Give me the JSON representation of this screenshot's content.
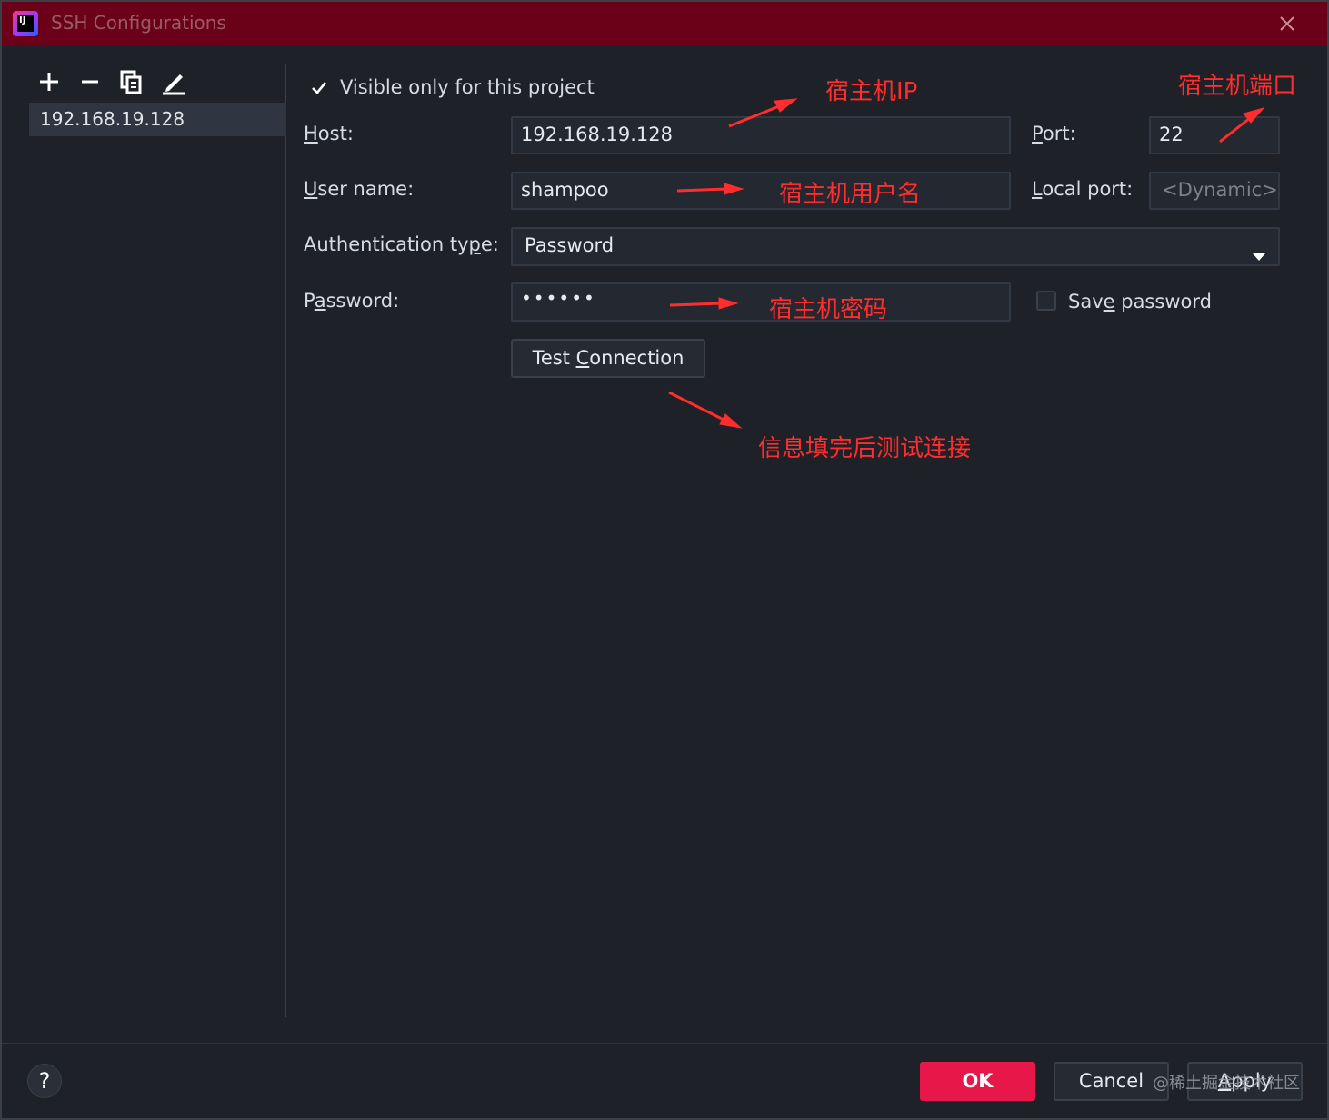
{
  "window": {
    "title": "SSH Configurations",
    "logo_text": "IJ"
  },
  "sidebar": {
    "toolbar": [
      "add-icon",
      "remove-icon",
      "copy-icon",
      "edit-icon"
    ],
    "items": [
      {
        "label": "192.168.19.128",
        "selected": true
      }
    ]
  },
  "form": {
    "visible_only_label": "Visible only for this project",
    "visible_only_checked": true,
    "host": {
      "label_prefix": "",
      "label_mnemonic": "H",
      "label_rest": "ost:",
      "value": "192.168.19.128"
    },
    "port": {
      "label_mnemonic": "P",
      "label_rest": "ort:",
      "value": "22"
    },
    "user_name": {
      "label_mnemonic": "U",
      "label_rest": "ser name:",
      "value": "shampoo"
    },
    "local_port": {
      "label_mnemonic": "L",
      "label_rest": "ocal port:",
      "placeholder": "<Dynamic>"
    },
    "auth_type": {
      "label_pre": "Authentication ty",
      "label_mnemonic": "p",
      "label_rest": "e:",
      "value": "Password"
    },
    "password": {
      "label_pre": "P",
      "label_mnemonic": "a",
      "label_rest": "ssword:",
      "value": "••••••"
    },
    "save_password": {
      "label_pre": "Sav",
      "label_mnemonic": "e",
      "label_rest": " password",
      "checked": false
    },
    "test_connection": {
      "label_pre": "Test ",
      "label_mnemonic": "C",
      "label_rest": "onnection"
    }
  },
  "annotations": {
    "host_ip": "宿主机IP",
    "host_port": "宿主机端口",
    "host_user": "宿主机用户名",
    "host_password": "宿主机密码",
    "test_note": "信息填完后测试连接"
  },
  "footer": {
    "help": "?",
    "ok": "OK",
    "cancel": "Cancel",
    "apply_mnemonic": "A",
    "apply_rest": "pply",
    "watermark": "@稀土掘金技术社区"
  },
  "colors": {
    "titlebar": "#6b0019",
    "accent": "#e8174a",
    "annotation": "#ff2d2d",
    "background": "#1e2127"
  }
}
